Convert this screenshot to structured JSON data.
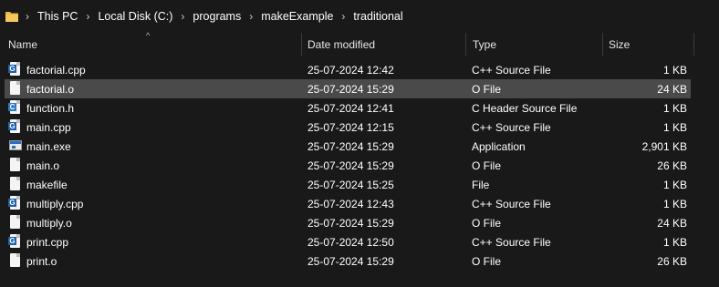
{
  "address_bar": {
    "crumbs": [
      "This PC",
      "Local Disk (C:)",
      "programs",
      "makeExample",
      "traditional"
    ]
  },
  "columns": {
    "name": "Name",
    "date_modified": "Date modified",
    "type": "Type",
    "size": "Size"
  },
  "files": [
    {
      "name": "factorial.cpp",
      "date": "25-07-2024 12:42",
      "type": "C++ Source File",
      "size": "1 KB",
      "icon": "cpp-file-icon"
    },
    {
      "name": "factorial.o",
      "date": "25-07-2024 15:29",
      "type": "O File",
      "size": "24 KB",
      "icon": "generic-file-icon",
      "selected": true
    },
    {
      "name": "function.h",
      "date": "25-07-2024 12:41",
      "type": "C Header Source File",
      "size": "1 KB",
      "icon": "header-file-icon"
    },
    {
      "name": "main.cpp",
      "date": "25-07-2024 12:15",
      "type": "C++ Source File",
      "size": "1 KB",
      "icon": "cpp-file-icon"
    },
    {
      "name": "main.exe",
      "date": "25-07-2024 15:29",
      "type": "Application",
      "size": "2,901 KB",
      "icon": "application-icon"
    },
    {
      "name": "main.o",
      "date": "25-07-2024 15:29",
      "type": "O File",
      "size": "26 KB",
      "icon": "generic-file-icon"
    },
    {
      "name": "makefile",
      "date": "25-07-2024 15:25",
      "type": "File",
      "size": "1 KB",
      "icon": "generic-file-icon"
    },
    {
      "name": "multiply.cpp",
      "date": "25-07-2024 12:43",
      "type": "C++ Source File",
      "size": "1 KB",
      "icon": "cpp-file-icon"
    },
    {
      "name": "multiply.o",
      "date": "25-07-2024 15:29",
      "type": "O File",
      "size": "24 KB",
      "icon": "generic-file-icon"
    },
    {
      "name": "print.cpp",
      "date": "25-07-2024 12:50",
      "type": "C++ Source File",
      "size": "1 KB",
      "icon": "cpp-file-icon"
    },
    {
      "name": "print.o",
      "date": "25-07-2024 15:29",
      "type": "O File",
      "size": "26 KB",
      "icon": "generic-file-icon"
    }
  ],
  "colors": {
    "background": "#191919",
    "selected_row": "#4a4a4a",
    "folder": "#e8b84a",
    "cpp_badge": "#1f5fa6",
    "c_badge": "#2f78c4"
  }
}
